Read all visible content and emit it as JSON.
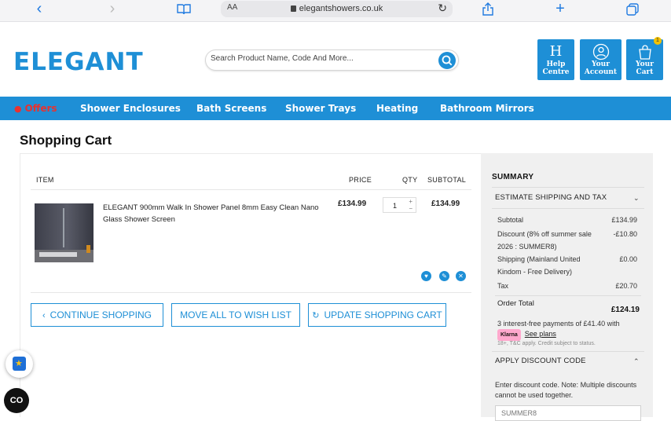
{
  "browser": {
    "text_size_label": "AA",
    "url": "elegantshowers.co.uk"
  },
  "header": {
    "logo": "ELEGANT",
    "search_placeholder": "Search Product Name, Code And More...",
    "help": {
      "icon": "H",
      "line1": "Help",
      "line2": "Centre"
    },
    "account": {
      "line1": "Your",
      "line2": "Account"
    },
    "cart": {
      "line1": "Your",
      "line2": "Cart",
      "count": "1"
    }
  },
  "nav": {
    "items": [
      "Offers",
      "Shower Enclosures",
      "Bath Screens",
      "Shower Trays",
      "Heating",
      "Bathroom Mirrors"
    ]
  },
  "page": {
    "title": "Shopping Cart"
  },
  "cart": {
    "headers": {
      "item": "ITEM",
      "price": "PRICE",
      "qty": "QTY",
      "subtotal": "SUBTOTAL"
    },
    "item": {
      "name": "ELEGANT 900mm Walk In Shower Panel 8mm Easy Clean Nano Glass Shower Screen",
      "price": "£134.99",
      "qty": "1",
      "subtotal": "£134.99"
    },
    "buttons": {
      "continue": "CONTINUE SHOPPING",
      "wishlist": "MOVE ALL TO WISH LIST",
      "update": "UPDATE SHOPPING CART"
    }
  },
  "summary": {
    "title": "SUMMARY",
    "shipping_toggle": "ESTIMATE SHIPPING AND TAX",
    "subtotal_label": "Subtotal",
    "subtotal_value": "£134.99",
    "discount_label": "Discount (8% off summer sale 2026 : SUMMER8)",
    "discount_value": "-£10.80",
    "shipping_label": "Shipping (Mainland United Kindom - Free Delivery)",
    "shipping_value": "£0.00",
    "tax_label": "Tax",
    "tax_value": "£20.70",
    "total_label": "Order Total",
    "total_value": "£124.19",
    "klarna_text": "3 interest-free payments of £41.40 with",
    "klarna_brand": "Klarna",
    "see_plans": "See plans",
    "tnc": "18+, T&C apply. Credit subject to status.",
    "discount_toggle": "APPLY DISCOUNT CODE",
    "discount_note": "Enter discount code. Note: Multiple discounts cannot be used together.",
    "discount_code": "SUMMER8"
  },
  "colors": {
    "brand": "#1e8fd6",
    "offers": "#e8322f"
  }
}
